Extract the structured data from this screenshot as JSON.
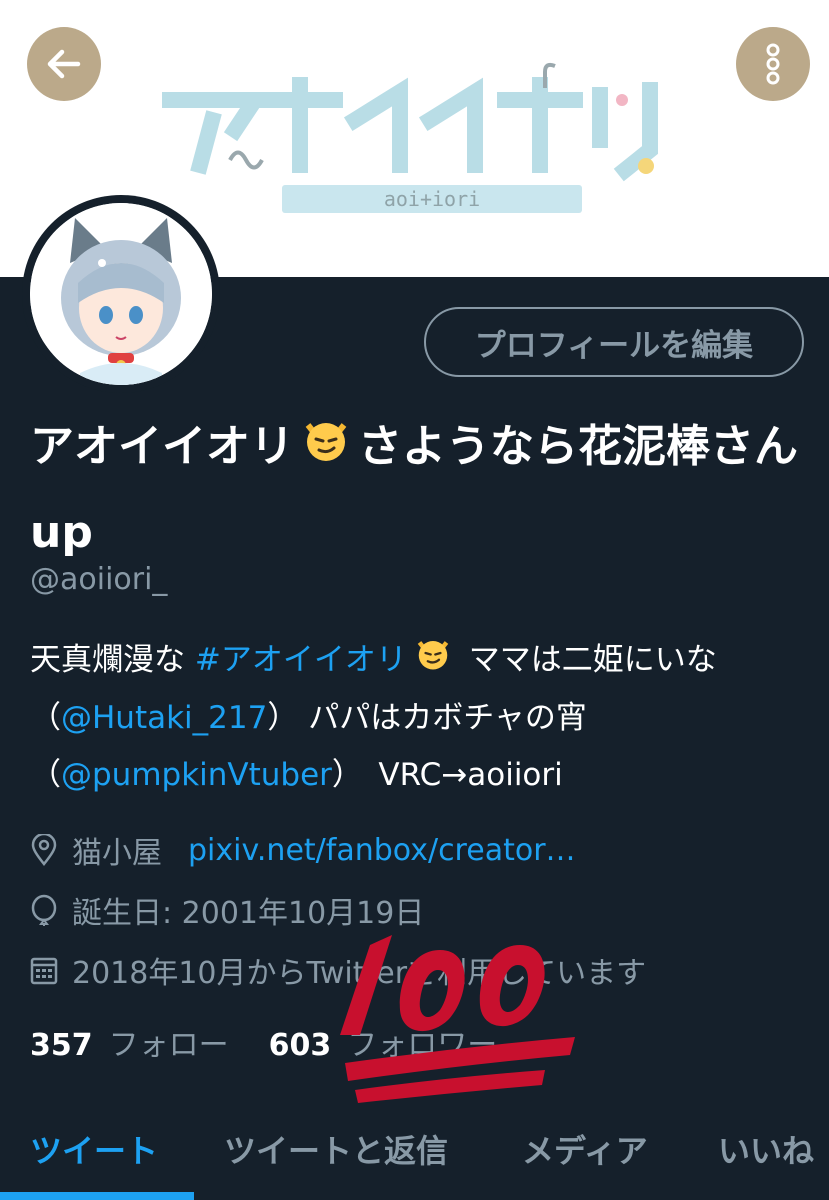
{
  "header": {
    "logo_text": "アオイイオリ",
    "logo_subtext": "aoi+iori",
    "back_icon": "arrow-left-icon",
    "more_icon": "vertical-dots-icon"
  },
  "profile": {
    "edit_button_label": "プロフィールを編集",
    "display_name_part1": "アオイイオリ",
    "display_name_part2": "さようなら花泥棒さんup",
    "handle": "@aoiiori_",
    "bio": {
      "text1": "天真爛漫な ",
      "hashtag": "#アオイイオリ",
      "text2": " ママは二姫にいな（",
      "mention1": "@Hutaki_217",
      "text3": "） パパはカボチャの宵（",
      "mention2": "@pumpkinVtuber",
      "text4": "）　VRC→aoiiori"
    },
    "location": "猫小屋",
    "website": "pixiv.net/fanbox/creator…",
    "birthday": "誕生日: 2001年10月19日",
    "joined": "2018年10月からTwitterを利用しています",
    "following_count": "357",
    "following_label": "フォロー",
    "followers_count": "603",
    "followers_label": "フォロワー"
  },
  "tabs": [
    {
      "label": "ツイート",
      "active": true
    },
    {
      "label": "ツイートと返信",
      "active": false
    },
    {
      "label": "メディア",
      "active": false
    },
    {
      "label": "いいね",
      "active": false
    }
  ],
  "colors": {
    "background": "#15202b",
    "accent": "#1da1f2",
    "muted": "#8899a6",
    "hundred_red": "#c8102e"
  }
}
